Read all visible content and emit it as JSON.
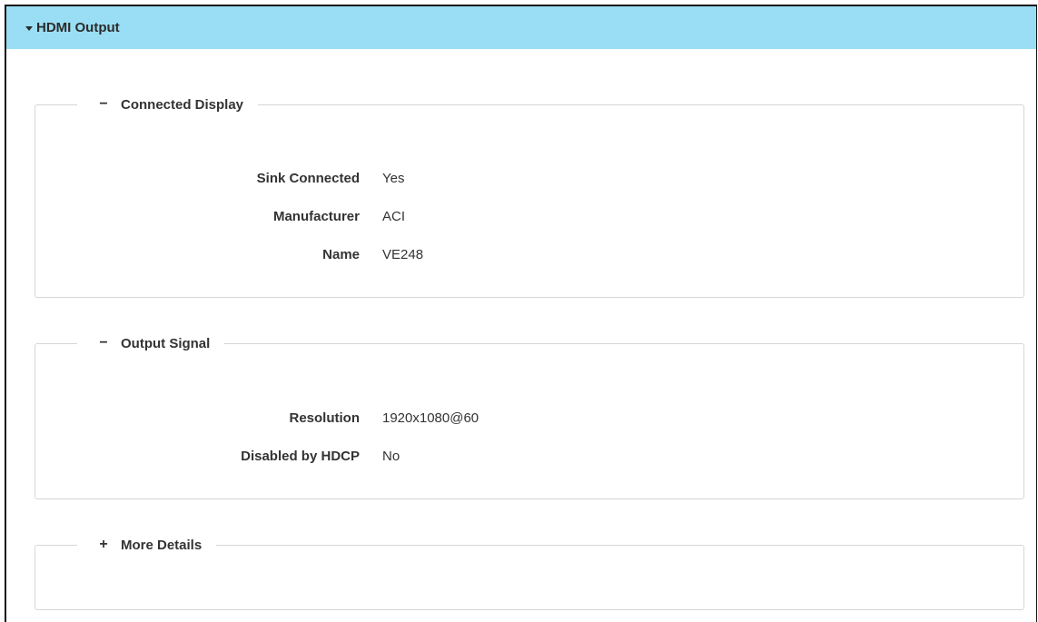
{
  "header": {
    "title": "HDMI Output"
  },
  "connected_display": {
    "toggle": "−",
    "title": "Connected Display",
    "rows": [
      {
        "label": "Sink Connected",
        "value": "Yes"
      },
      {
        "label": "Manufacturer",
        "value": "ACI"
      },
      {
        "label": "Name",
        "value": "VE248"
      }
    ]
  },
  "output_signal": {
    "toggle": "−",
    "title": "Output Signal",
    "rows": [
      {
        "label": "Resolution",
        "value": "1920x1080@60"
      },
      {
        "label": "Disabled by HDCP",
        "value": "No"
      }
    ]
  },
  "more_details": {
    "toggle": "+",
    "title": "More Details"
  },
  "colors": {
    "header_bg": "#99def4",
    "border": "#d6d6d6"
  }
}
